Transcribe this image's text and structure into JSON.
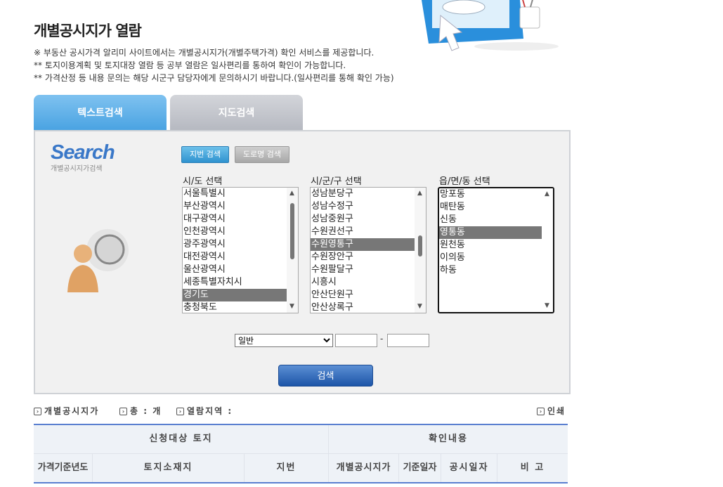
{
  "page": {
    "title": "개별공시지가 열람",
    "notes": [
      "※ 부동산 공시가격 알리미 사이트에서는 개별공시지가(개별주택가격) 확인 서비스를 제공합니다.",
      "** 토지이용계획 및 토지대장 열람 등 공부 열람은 일사편리를 통하여 확인이 가능합니다.",
      "** 가격산정 등 내용 문의는 해당 시군구 담당자에게 문의하시기 바랍니다.(일사편리를 통해 확인 가능)"
    ]
  },
  "tabs": {
    "text_search": "텍스트검색",
    "map_search": "지도검색"
  },
  "search_panel": {
    "logo_word": "Search",
    "logo_sub": "개별공시지가검색",
    "mode_buttons": {
      "jibun": "지번 검색",
      "road": "도로명 검색"
    },
    "sido": {
      "label": "시/도 선택",
      "items": [
        "서울특별시",
        "부산광역시",
        "대구광역시",
        "인천광역시",
        "광주광역시",
        "대전광역시",
        "울산광역시",
        "세종특별자치시",
        "경기도",
        "충청북도"
      ],
      "selected": "경기도"
    },
    "sigungu": {
      "label": "시/군/구 선택",
      "items": [
        "성남분당구",
        "성남수정구",
        "성남중원구",
        "수원권선구",
        "수원영통구",
        "수원장안구",
        "수원팔달구",
        "시흥시",
        "안산단원구",
        "안산상록구"
      ],
      "selected": "수원영통구"
    },
    "dong": {
      "label": "읍/면/동 선택",
      "items": [
        "망포동",
        "매탄동",
        "신동",
        "영통동",
        "원천동",
        "이의동",
        "하동"
      ],
      "selected": "영통동"
    },
    "land_type": {
      "selected": "일반"
    },
    "bunji_separator": "-",
    "search_button": "검색"
  },
  "result_info": {
    "category": "개별공시지가",
    "total": "총 : 개",
    "region": "열람지역 :",
    "print": "인쇄"
  },
  "table": {
    "group_headers": {
      "target": "신청대상 토지",
      "confirm": "확인내용"
    },
    "columns": [
      "가격기준년도",
      "토지소재지",
      "지번",
      "개별공시지가",
      "기준일자",
      "공시일자",
      "비 고"
    ]
  },
  "colors": {
    "accent": "#4aa3e2",
    "button_blue": "#1d55a8",
    "selected_row": "#777777"
  }
}
